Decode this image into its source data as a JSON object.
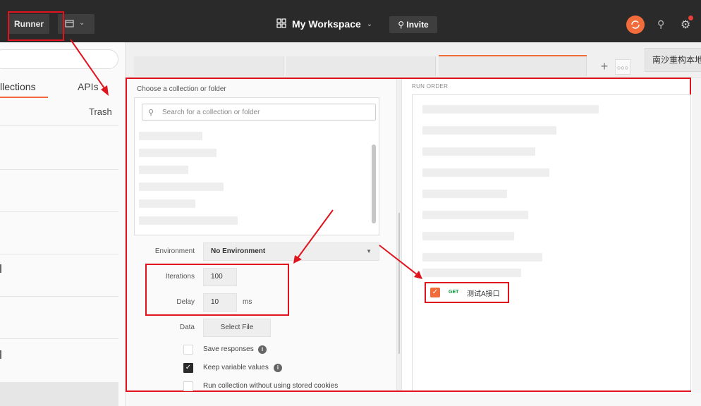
{
  "topbar": {
    "runner_label": "Runner",
    "workspace_label": "My Workspace",
    "invite_label": "Invite"
  },
  "sidebar": {
    "tabs": [
      {
        "label": "llections",
        "active": true
      },
      {
        "label": "APIs"
      }
    ],
    "trash_label": "Trash"
  },
  "tabs": {
    "right_tab_label": "南沙重构本地"
  },
  "runner": {
    "choose_label": "Choose a collection or folder",
    "search_placeholder": "Search for a collection or folder",
    "environment": {
      "label": "Environment",
      "value": "No Environment"
    },
    "iterations": {
      "label": "Iterations",
      "value": "100"
    },
    "delay": {
      "label": "Delay",
      "value": "10",
      "unit": "ms"
    },
    "data": {
      "label": "Data",
      "button_label": "Select File"
    },
    "options": [
      {
        "label": "Save responses",
        "checked": false,
        "info": true
      },
      {
        "label": "Keep variable values",
        "checked": true,
        "info": true
      },
      {
        "label": "Run collection without using stored cookies",
        "checked": false,
        "info": false
      }
    ],
    "run_order": {
      "label": "RUN ORDER",
      "items": [
        {
          "method": "GET",
          "name": "测试A接口",
          "checked": true
        }
      ]
    }
  },
  "colors": {
    "accent": "#f26b3a",
    "annotation_red": "#e0141e",
    "topbar_bg": "#2a2a2a",
    "get_method": "#0b9a3a"
  }
}
